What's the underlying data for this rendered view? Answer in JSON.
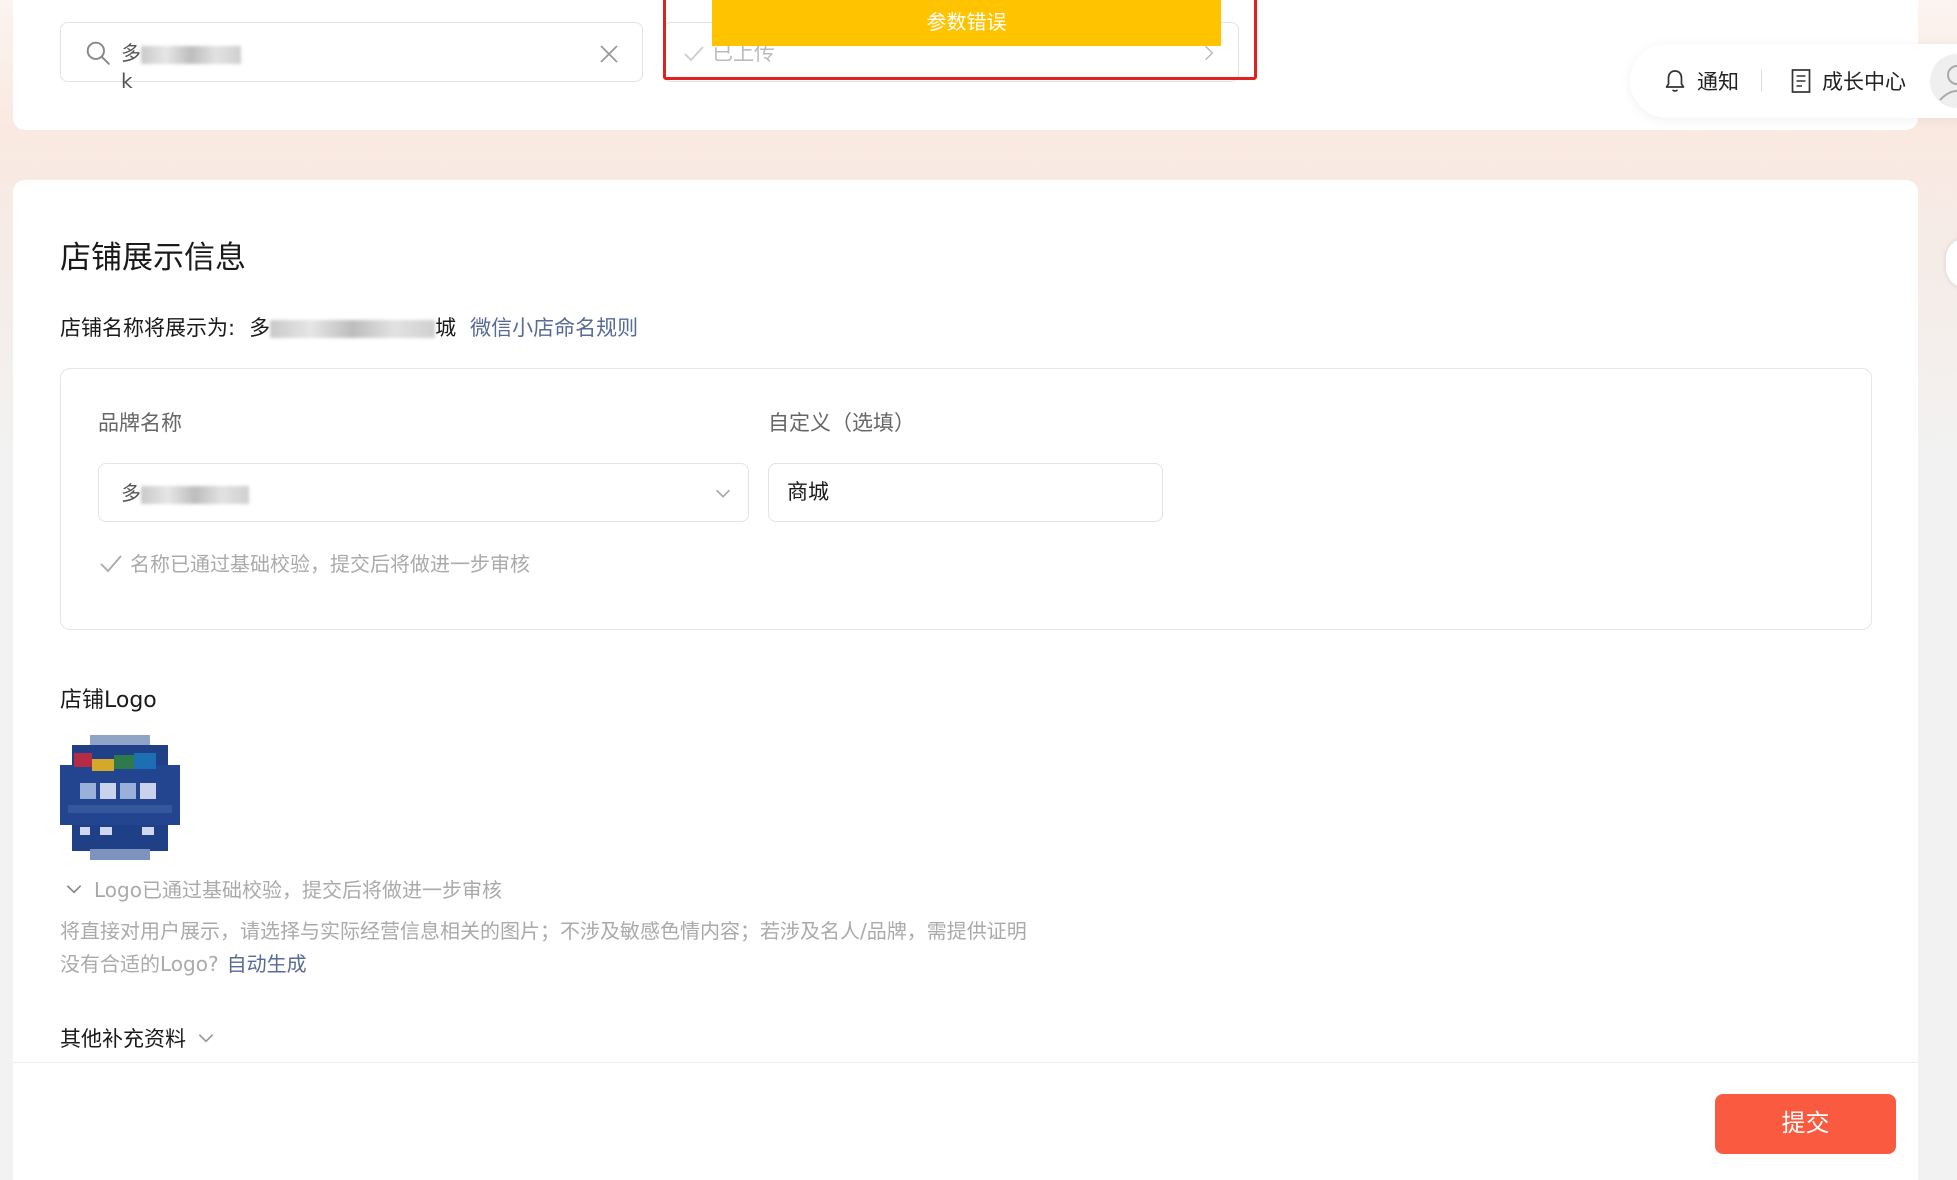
{
  "search": {
    "value_prefix": "多",
    "value_suffix": "k"
  },
  "upload": {
    "status_label": "已上传"
  },
  "toast": {
    "message": "参数错误",
    "color": "#ffc300"
  },
  "header": {
    "notify_label": "通知",
    "growth_label": "成长中心"
  },
  "section": {
    "title": "店铺展示信息",
    "shop_name_label": "店铺名称将展示为:",
    "shop_name_prefix": "多",
    "shop_name_suffix": "城",
    "naming_rules_link": "微信小店命名规则"
  },
  "brand": {
    "brand_label": "品牌名称",
    "brand_value_prefix": "多",
    "custom_label": "自定义（选填）",
    "custom_value": "商城",
    "name_hint": "名称已通过基础校验，提交后将做进一步审核"
  },
  "logo": {
    "title": "店铺Logo",
    "hint": "Logo已通过基础校验，提交后将做进一步审核",
    "note": "将直接对用户展示，请选择与实际经营信息相关的图片；不涉及敏感色情内容；若涉及名人/品牌，需提供证明",
    "no_logo_text": "没有合适的Logo?",
    "auto_generate_link": "自动生成"
  },
  "more": {
    "label": "其他补充资料"
  },
  "footer": {
    "submit_label": "提交"
  },
  "colors": {
    "accent": "#fa5b40",
    "link": "#576b95",
    "alert_border": "#e0211d"
  }
}
